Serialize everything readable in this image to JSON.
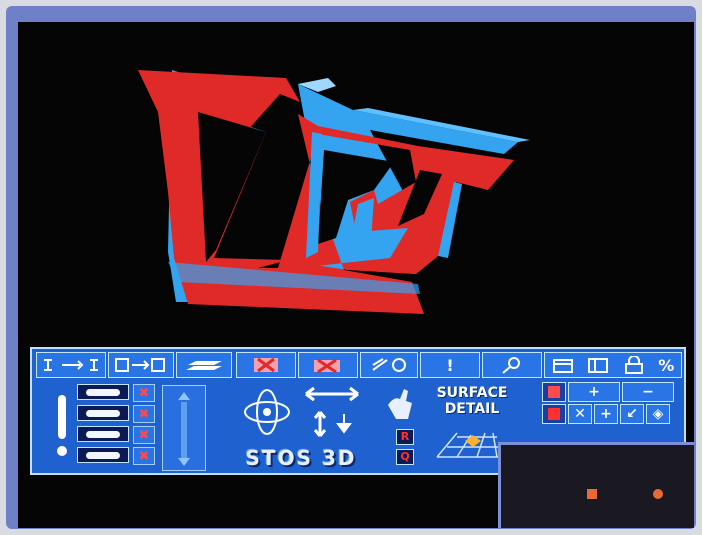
{
  "toolbar": {
    "top_buttons": [
      "link",
      "move-to",
      "layers",
      "delete",
      "delete-multi",
      "scale",
      "info",
      "zoom",
      "view-options"
    ],
    "info_label": "!",
    "logo_text": "STOS 3D",
    "surface_detail": [
      "SURFACE",
      "DETAIL"
    ],
    "r_label": "R",
    "q_label": "Q",
    "right_grid": [
      "+",
      "−",
      "✕",
      "+",
      "↙",
      "◈"
    ],
    "percent": "%"
  },
  "colors": {
    "model_red": "#e02a28",
    "model_blue": "#34a3f0",
    "toolbar_bg": "#1f62cf",
    "frame": "#6f80c8"
  }
}
